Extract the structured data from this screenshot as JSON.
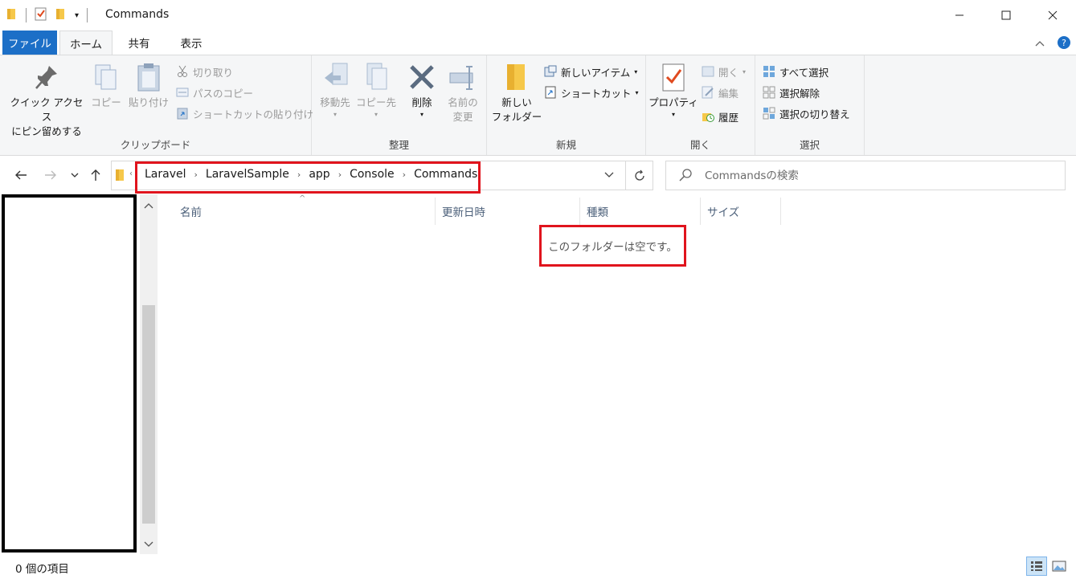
{
  "window": {
    "title": "Commands"
  },
  "ribbon_tabs": [
    {
      "label": "ファイル"
    },
    {
      "label": "ホーム"
    },
    {
      "label": "共有"
    },
    {
      "label": "表示"
    }
  ],
  "clipboard": {
    "pin_label_1": "クイック アクセス",
    "pin_label_2": "にピン留めする",
    "copy": "コピー",
    "paste": "貼り付け",
    "cut": "切り取り",
    "copy_path": "パスのコピー",
    "paste_shortcut": "ショートカットの貼り付け",
    "group": "クリップボード"
  },
  "organize": {
    "move_to": "移動先",
    "copy_to": "コピー先",
    "delete": "削除",
    "rename_1": "名前の",
    "rename_2": "変更",
    "group": "整理"
  },
  "new": {
    "new_folder_1": "新しい",
    "new_folder_2": "フォルダー",
    "new_item": "新しいアイテム",
    "shortcut": "ショートカット",
    "group": "新規"
  },
  "open": {
    "properties": "プロパティ",
    "open": "開く",
    "edit": "編集",
    "history": "履歴",
    "group": "開く"
  },
  "select": {
    "select_all": "すべて選択",
    "select_none": "選択解除",
    "invert": "選択の切り替え",
    "group": "選択"
  },
  "breadcrumbs": [
    "Laravel",
    "LaravelSample",
    "app",
    "Console",
    "Commands"
  ],
  "search": {
    "placeholder": "Commandsの検索"
  },
  "columns": [
    "名前",
    "更新日時",
    "種類",
    "サイズ"
  ],
  "empty_message": "このフォルダーは空です。",
  "status": {
    "item_count": "0 個の項目"
  },
  "colors": {
    "file_tab": "#1c6fc7",
    "highlight": "#e0141d",
    "folder": "#f6c84a"
  }
}
